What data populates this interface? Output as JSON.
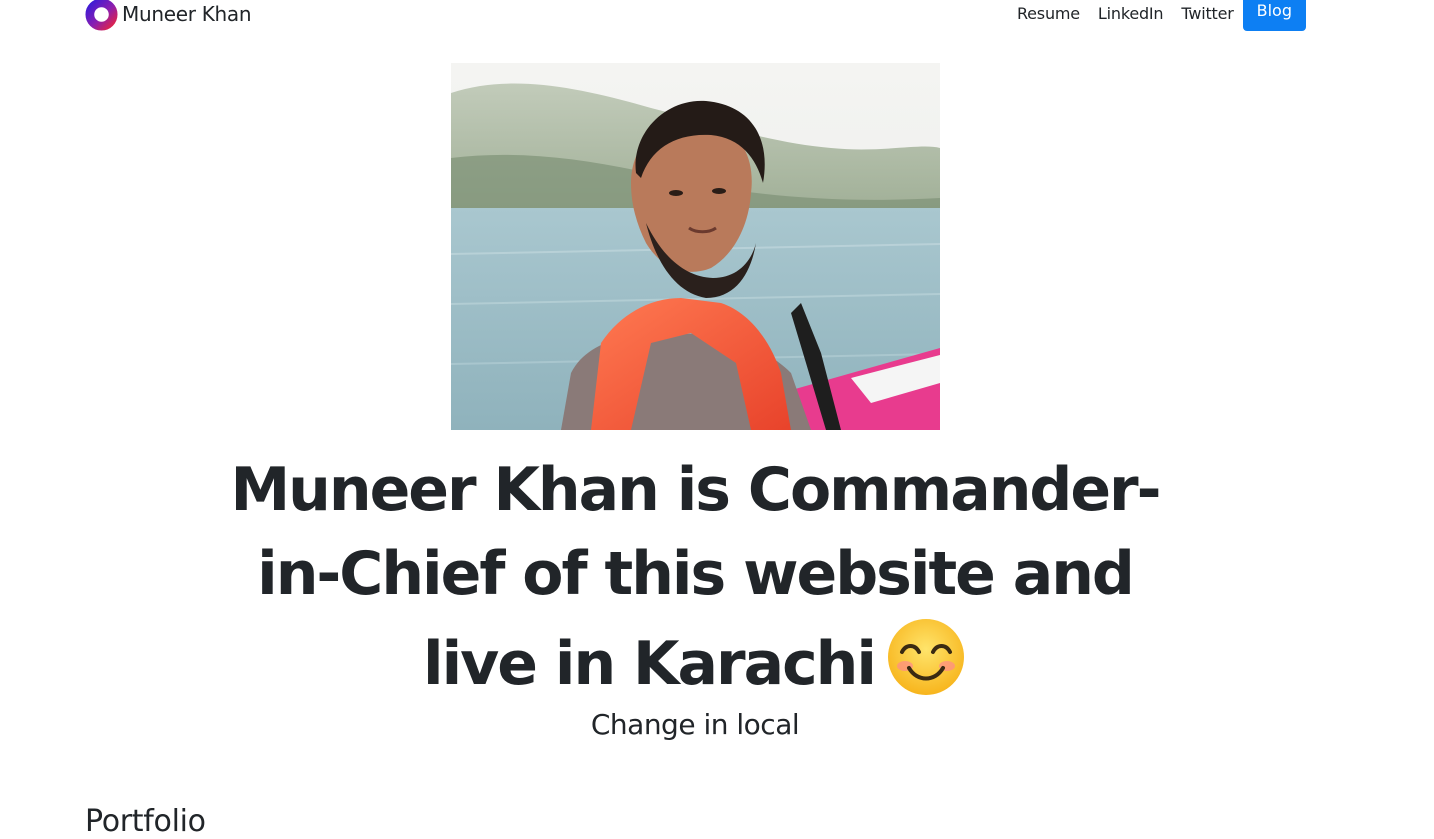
{
  "navbar": {
    "brand_name": "Muneer Khan",
    "links": [
      {
        "label": "Resume"
      },
      {
        "label": "LinkedIn"
      },
      {
        "label": "Twitter"
      }
    ],
    "cta_label": "Blog"
  },
  "hero": {
    "headline_lines": [
      "Muneer Khan is Commander-",
      "in-Chief of this website and",
      "live in Karachi"
    ],
    "emoji": "smiling-face-emoji",
    "subtitle": "Change in local"
  },
  "sections": {
    "portfolio_heading": "Portfolio"
  },
  "colors": {
    "accent": "#0d7ff3",
    "text": "#212529",
    "background": "#ffffff"
  }
}
